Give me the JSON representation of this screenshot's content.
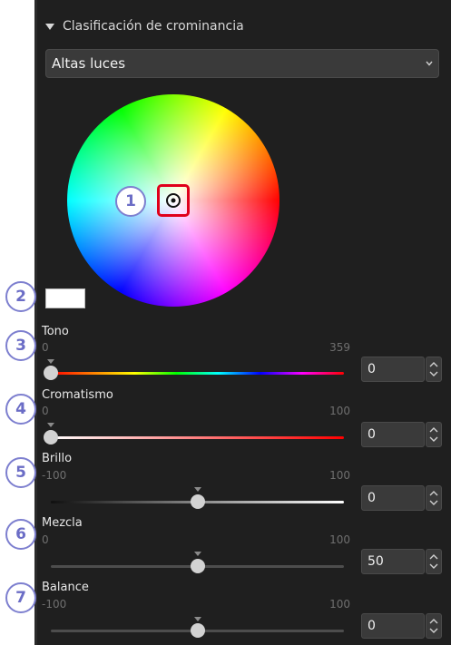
{
  "section": {
    "title": "Clasificación de crominancia"
  },
  "range_select": {
    "value": "Altas luces"
  },
  "callouts": [
    "1",
    "2",
    "3",
    "4",
    "5",
    "6",
    "7"
  ],
  "sliders": [
    {
      "label": "Tono",
      "min": "0",
      "max": "359",
      "value": "0",
      "level": 0.0,
      "track": "hue"
    },
    {
      "label": "Cromatismo",
      "min": "0",
      "max": "100",
      "value": "0",
      "level": 0.0,
      "track": "chroma"
    },
    {
      "label": "Brillo",
      "min": "-100",
      "max": "100",
      "value": "0",
      "level": 0.5,
      "track": "bright"
    },
    {
      "label": "Mezcla",
      "min": "0",
      "max": "100",
      "value": "50",
      "level": 0.5,
      "track": "plain"
    },
    {
      "label": "Balance",
      "min": "-100",
      "max": "100",
      "value": "0",
      "level": 0.5,
      "track": "plain"
    }
  ],
  "colors": {
    "panel": "#1f1f1f",
    "highlight_box": "#e0001b",
    "callout_ring": "#7d7fcf"
  },
  "icons": {
    "section_toggle": "triangle-down-icon",
    "dropdown": "chevron-down-icon",
    "picker": "target-icon",
    "spinner": "up-down-arrows-icon"
  }
}
